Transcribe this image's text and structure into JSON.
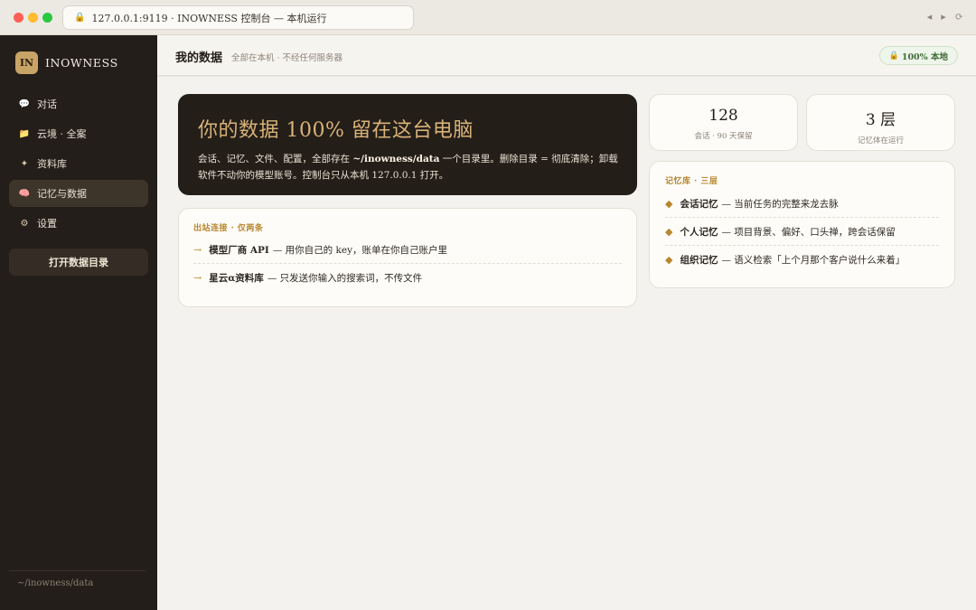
{
  "browser": {
    "url": "127.0.0.1:9119 · INOWNESS 控制台 — 本机运行",
    "back": "◂",
    "forward": "▸",
    "reload": "⟳"
  },
  "sidebar": {
    "logo": "IN",
    "brand": "INOWNESS",
    "items": [
      {
        "label": "对话",
        "icon": "chat-icon",
        "glyph": "💬"
      },
      {
        "label": "云境 · 全案",
        "icon": "folder-icon",
        "glyph": "📁"
      },
      {
        "label": "资料库",
        "icon": "sparkle-icon",
        "glyph": "✦"
      },
      {
        "label": "记忆与数据",
        "icon": "brain-icon",
        "glyph": "🧠",
        "active": true
      },
      {
        "label": "设置",
        "icon": "gear-icon",
        "glyph": "⚙"
      }
    ],
    "open_dir": "打开数据目录",
    "path": "~/inowness/data"
  },
  "header": {
    "title": "我的数据",
    "subtitle": "全部在本机 · 不经任何服务器",
    "badge": "100% 本地"
  },
  "hero": {
    "title": "你的数据 100% 留在这台电脑",
    "desc_pre": "会话、记忆、文件、配置，全部存在 ",
    "desc_path": "~/inowness/data",
    "desc_post": " 一个目录里。删除目录 = 彻底清除；卸载软件不动你的模型账号。控制台只从本机 127.0.0.1 打开。"
  },
  "outbound": {
    "label": "出站连接 · 仅两条",
    "rows": [
      {
        "title": "模型厂商 API",
        "desc": "— 用你自己的 key，账单在你自己账户里"
      },
      {
        "title": "星云α资料库",
        "desc": "— 只发送你输入的搜索词，不传文件"
      }
    ]
  },
  "stats": [
    {
      "value": "128",
      "label": "会话 · 90 天保留"
    },
    {
      "value": "3 层",
      "label": "记忆体在运行"
    }
  ],
  "memory": {
    "label": "记忆库 · 三层",
    "rows": [
      {
        "title": "会话记忆",
        "desc": "— 当前任务的完整来龙去脉"
      },
      {
        "title": "个人记忆",
        "desc": "— 项目背景、偏好、口头禅，跨会话保留"
      },
      {
        "title": "组织记忆",
        "desc": "— 语义检索「上个月那个客户说什么来着」"
      }
    ]
  }
}
